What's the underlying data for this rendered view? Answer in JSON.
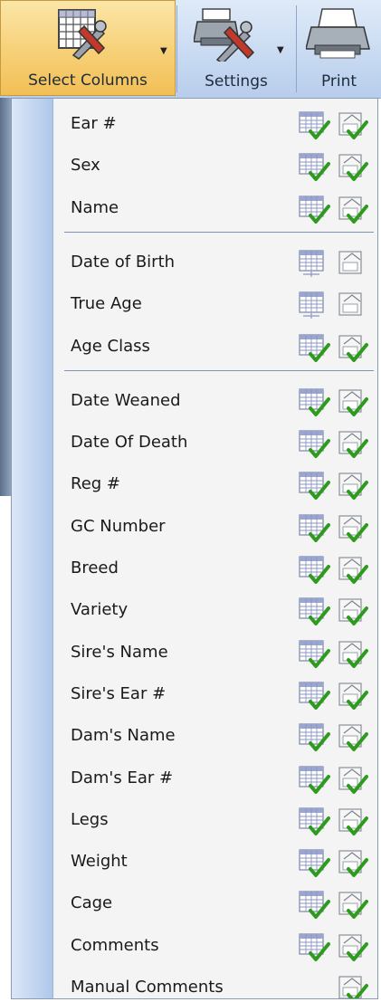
{
  "toolbar": {
    "select_columns_label": "Select Columns",
    "settings_label": "Settings",
    "print_label": "Print"
  },
  "menu": {
    "groups": [
      {
        "items": [
          {
            "label": "Ear #",
            "grid_checked": true,
            "print_checked": true
          },
          {
            "label": "Sex",
            "grid_checked": true,
            "print_checked": true
          },
          {
            "label": "Name",
            "grid_checked": true,
            "print_checked": true
          }
        ]
      },
      {
        "items": [
          {
            "label": "Date of Birth",
            "grid_checked": false,
            "print_checked": false
          },
          {
            "label": "True Age",
            "grid_checked": false,
            "print_checked": false
          },
          {
            "label": "Age Class",
            "grid_checked": true,
            "print_checked": true
          }
        ]
      },
      {
        "items": [
          {
            "label": "Date Weaned",
            "grid_checked": true,
            "print_checked": true
          },
          {
            "label": "Date Of Death",
            "grid_checked": true,
            "print_checked": true
          },
          {
            "label": "Reg #",
            "grid_checked": true,
            "print_checked": true
          },
          {
            "label": "GC Number",
            "grid_checked": true,
            "print_checked": true
          },
          {
            "label": "Breed",
            "grid_checked": true,
            "print_checked": true
          },
          {
            "label": "Variety",
            "grid_checked": true,
            "print_checked": true
          },
          {
            "label": "Sire's Name",
            "grid_checked": true,
            "print_checked": true
          },
          {
            "label": "Sire's Ear #",
            "grid_checked": true,
            "print_checked": true
          },
          {
            "label": "Dam's Name",
            "grid_checked": true,
            "print_checked": true
          },
          {
            "label": "Dam's Ear #",
            "grid_checked": true,
            "print_checked": true
          },
          {
            "label": "Legs",
            "grid_checked": true,
            "print_checked": true
          },
          {
            "label": "Weight",
            "grid_checked": true,
            "print_checked": true
          },
          {
            "label": "Cage",
            "grid_checked": true,
            "print_checked": true
          },
          {
            "label": "Comments",
            "grid_checked": true,
            "print_checked": true
          },
          {
            "label": "Manual Comments",
            "grid_checked": null,
            "print_checked": true
          }
        ]
      }
    ]
  },
  "icons": {
    "select_columns": "grid-tools-icon",
    "settings": "printer-tools-icon",
    "print": "printer-icon",
    "dropdown": "chevron-down-icon",
    "grid_column": "grid-column-icon",
    "print_column": "print-column-icon",
    "check": "check-icon"
  },
  "colors": {
    "active_button": "#f7d27b",
    "toolbar": "#c9dbf2",
    "menu_bg": "#f4f4f4",
    "gutter": "#c3d6f0",
    "check": "#2e9b1e"
  }
}
